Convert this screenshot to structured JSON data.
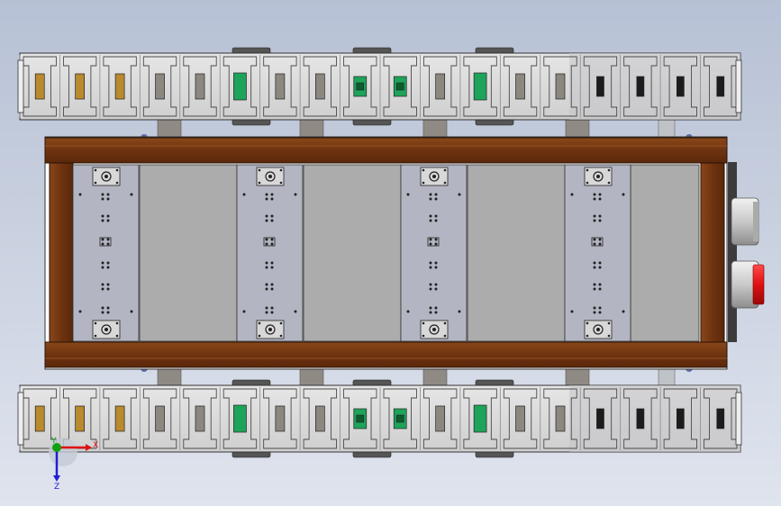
{
  "viewport": {
    "background_top": "#b7c1d5",
    "background_bottom": "#dfe4ee"
  },
  "colors": {
    "frame_wood": "#6e3310",
    "frame_wood_highlight": "#9a5527",
    "chain_link": "#d9d9d9",
    "chain_link_shadow": "#a5a5a5",
    "mount_plate": "#b3b6c2",
    "cover_panel": "#ababab",
    "accent_green": "#1ea35a",
    "accent_gold": "#b98a2e",
    "accent_red": "#e01010",
    "bolt_dark": "#222222"
  },
  "chain_top": {
    "accents": [
      "gold",
      "gold",
      "gold",
      "gray",
      "gray",
      "green",
      "gray",
      "gray",
      "green-block",
      "green-block",
      "gray",
      "green",
      "gray",
      "gray",
      "dark",
      "dark",
      "dark",
      "dark"
    ]
  },
  "chain_bottom": {
    "accents": [
      "gold",
      "gold",
      "gold",
      "gray",
      "gray",
      "green",
      "gray",
      "gray",
      "green-block",
      "green-block",
      "gray",
      "green",
      "gray",
      "gray",
      "dark",
      "dark",
      "dark",
      "dark"
    ]
  },
  "triad": {
    "x_label": "X",
    "y_label": "Y",
    "z_label": "Z",
    "x_color": "#e01010",
    "y_color": "#10a010",
    "z_color": "#2020d0"
  }
}
